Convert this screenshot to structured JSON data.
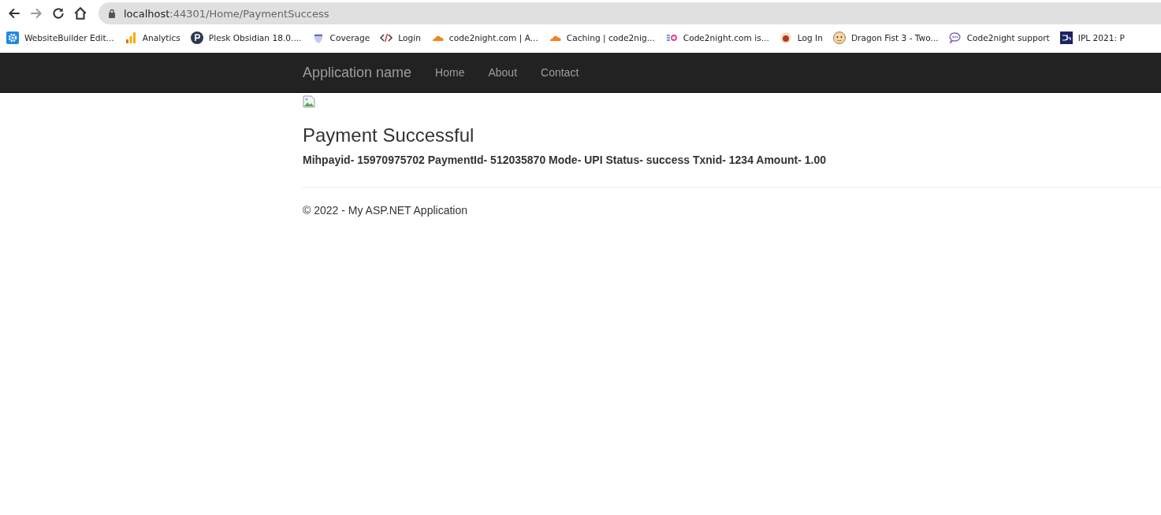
{
  "browser": {
    "url": {
      "host": "localhost",
      "path": ":44301/Home/PaymentSuccess"
    },
    "bookmarks": [
      {
        "label": "WebsiteBuilder Edit...",
        "kind": "gear"
      },
      {
        "label": "Analytics",
        "kind": "bars"
      },
      {
        "label": "Plesk Obsidian 18.0....",
        "kind": "p-circle"
      },
      {
        "label": "Coverage",
        "kind": "shield"
      },
      {
        "label": "Login",
        "kind": "code"
      },
      {
        "label": "code2night.com | A...",
        "kind": "cloud"
      },
      {
        "label": "Caching | code2nig...",
        "kind": "cloud"
      },
      {
        "label": "Code2night.com is...",
        "kind": "sg"
      },
      {
        "label": "Log In",
        "kind": "round"
      },
      {
        "label": "Dragon Fist 3 - Two...",
        "kind": "face"
      },
      {
        "label": "Code2night support",
        "kind": "chat"
      },
      {
        "label": "IPL 2021: P",
        "kind": "dh"
      }
    ]
  },
  "navbar": {
    "brand": "Application name",
    "links": [
      "Home",
      "About",
      "Contact"
    ]
  },
  "content": {
    "heading": "Payment Successful",
    "details": "Mihpayid- 15970975702 PaymentId- 512035870 Mode- UPI Status- success Txnid- 1234 Amount- 1.00"
  },
  "footer": "© 2022 - My ASP.NET Application"
}
